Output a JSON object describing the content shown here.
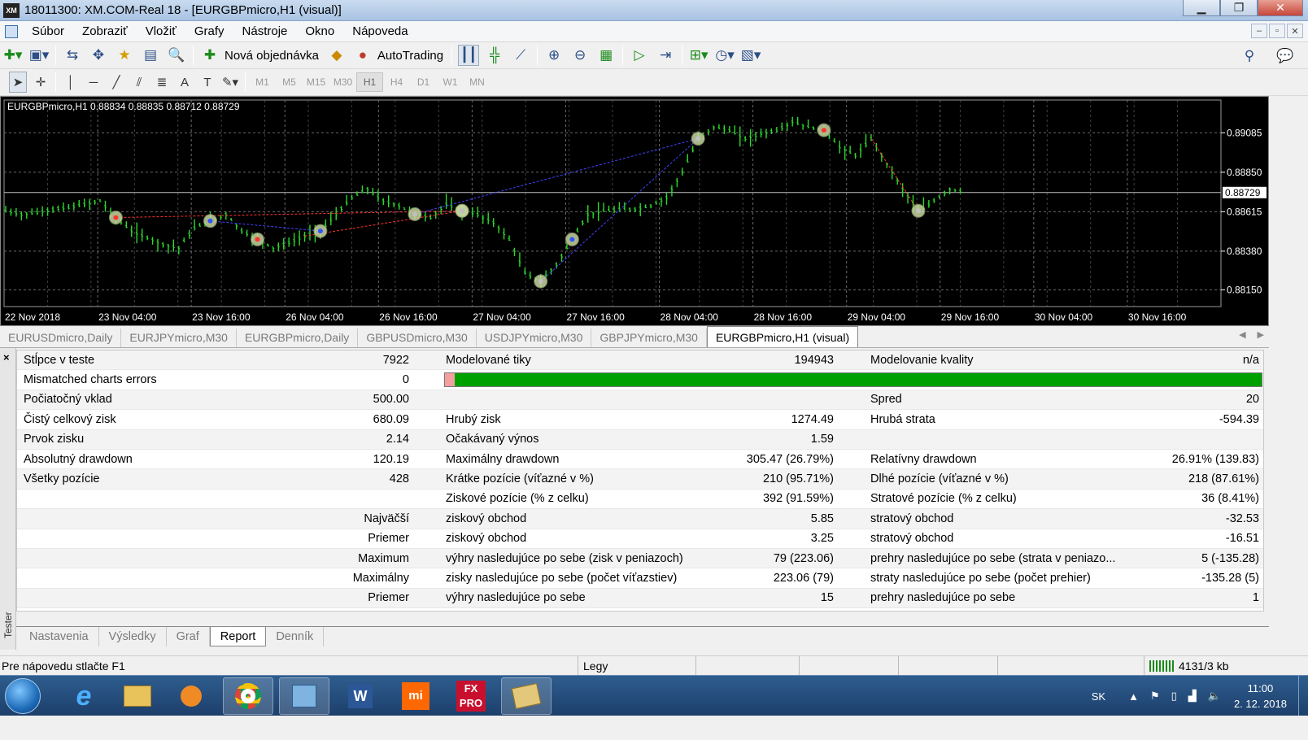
{
  "window": {
    "title": "18011300: XM.COM-Real 18 - [EURGBPmicro,H1 (visual)]",
    "logo": "XM",
    "min": "▁",
    "max": "❐",
    "close": "✕"
  },
  "menu": [
    "Súbor",
    "Zobraziť",
    "Vložiť",
    "Grafy",
    "Nástroje",
    "Okno",
    "Nápoveda"
  ],
  "toolbar": {
    "new_order": "Nová objednávka",
    "autotrading": "AutoTrading"
  },
  "timeframes": [
    "M1",
    "M5",
    "M15",
    "M30",
    "H1",
    "H4",
    "D1",
    "W1",
    "MN"
  ],
  "timeframe_active": "H1",
  "chart": {
    "header": "EURGBPmicro,H1  0.88834 0.88835 0.88712 0.88729",
    "current_price": "0.88729",
    "colors": {
      "candle_up": "#2bd92b",
      "candle_down": "#2bd92b",
      "grid": "#6b6b6b",
      "background": "#000000",
      "text": "#ffffff",
      "current_line": "#c0c0c0",
      "buy_line": "#4444ff",
      "sell_line": "#ff3333"
    },
    "chart_data": {
      "type": "line",
      "title": "EURGBPmicro,H1",
      "yticks": [
        "0.89085",
        "0.88850",
        "0.88615",
        "0.88380",
        "0.88150"
      ],
      "ytick_values": [
        0.89085,
        0.8885,
        0.88615,
        0.8838,
        0.8815
      ],
      "ylim": [
        0.8805,
        0.8928
      ],
      "xticks": [
        "22 Nov 2018",
        "23 Nov 04:00",
        "23 Nov 16:00",
        "26 Nov 04:00",
        "26 Nov 16:00",
        "27 Nov 04:00",
        "27 Nov 16:00",
        "28 Nov 04:00",
        "28 Nov 16:00",
        "29 Nov 04:00",
        "29 Nov 16:00",
        "30 Nov 04:00",
        "30 Nov 16:00"
      ],
      "grid": true,
      "series": [
        {
          "values": [
            0.8862,
            0.886,
            0.8861,
            0.8863,
            0.8864,
            0.8866,
            0.8868,
            0.8858,
            0.885,
            0.8846,
            0.8842,
            0.884,
            0.8852,
            0.8856,
            0.886,
            0.885,
            0.8845,
            0.884,
            0.8843,
            0.8847,
            0.885,
            0.886,
            0.887,
            0.8875,
            0.8868,
            0.8865,
            0.886,
            0.8858,
            0.8866,
            0.8862,
            0.886,
            0.8855,
            0.8845,
            0.8825,
            0.882,
            0.883,
            0.8845,
            0.886,
            0.8862,
            0.8863,
            0.8863,
            0.8865,
            0.887,
            0.8885,
            0.8905,
            0.8912,
            0.891,
            0.8905,
            0.8908,
            0.891,
            0.8915,
            0.8912,
            0.891,
            0.89,
            0.8895,
            0.8905,
            0.889,
            0.8875,
            0.8862,
            0.8868,
            0.8875,
            0.8873
          ]
        }
      ]
    }
  },
  "chart_tabs": [
    "EURUSDmicro,Daily",
    "EURJPYmicro,M30",
    "EURGBPmicro,Daily",
    "GBPUSDmicro,M30",
    "USDJPYmicro,M30",
    "GBPJPYmicro,M30",
    "EURGBPmicro,H1 (visual)"
  ],
  "chart_tab_active": 6,
  "tester": {
    "close": "×",
    "label": "Tester"
  },
  "report": [
    [
      "Stĺpce v teste",
      "7922",
      "Modelované tiky",
      "194943",
      "Modelovanie kvality",
      "n/a"
    ],
    [
      "Mismatched charts errors",
      "0",
      "",
      "",
      "",
      ""
    ],
    [
      "Počiatočný vklad",
      "500.00",
      "",
      "",
      "Spred",
      "20"
    ],
    [
      "Čistý celkový zisk",
      "680.09",
      "Hrubý zisk",
      "1274.49",
      "Hrubá strata",
      "-594.39"
    ],
    [
      "Prvok zisku",
      "2.14",
      "Očakávaný výnos",
      "1.59",
      "",
      ""
    ],
    [
      "Absolutný drawdown",
      "120.19",
      "Maximálny drawdown",
      "305.47 (26.79%)",
      "Relatívny drawdown",
      "26.91% (139.83)"
    ],
    [
      "Všetky pozície",
      "428",
      "Krátke pozície (víťazné v %)",
      "210 (95.71%)",
      "Dlhé pozície (víťazné v %)",
      "218 (87.61%)"
    ],
    [
      "",
      "",
      "Ziskové pozície (% z celku)",
      "392 (91.59%)",
      "Stratové pozície (% z celku)",
      "36 (8.41%)"
    ],
    [
      "",
      "Najväčší",
      "ziskový obchod",
      "5.85",
      "stratový obchod",
      "-32.53"
    ],
    [
      "",
      "Priemer",
      "ziskový obchod",
      "3.25",
      "stratový obchod",
      "-16.51"
    ],
    [
      "",
      "Maximum",
      "výhry nasledujúce po sebe (zisk v peniazoch)",
      "79 (223.06)",
      "prehry nasledujúce po sebe (strata v peniazo...",
      "5 (-135.28)"
    ],
    [
      "",
      "Maximálny",
      "zisky nasledujúce po sebe (počet víťazstiev)",
      "223.06 (79)",
      "straty nasledujúce po sebe (počet prehier)",
      "-135.28 (5)"
    ],
    [
      "",
      "Priemer",
      "výhry nasledujúce po sebe",
      "15",
      "prehry nasledujúce po sebe",
      "1"
    ]
  ],
  "modeling_quality_bar": {
    "mismatch_fraction": 0.012,
    "color_good": "#00a000",
    "color_bad": "#f2a0a0"
  },
  "tester_tabs": [
    "Nastavenia",
    "Výsledky",
    "Graf",
    "Report",
    "Denník"
  ],
  "tester_tab_active": 3,
  "status": {
    "help": "Pre nápovedu stlačte F1",
    "profile": "Legy",
    "traffic": "4131/3 kb"
  },
  "taskbar": {
    "lang": "SK",
    "time": "11:00",
    "date": "2. 12. 2018",
    "apps": [
      "internet-explorer",
      "file-explorer",
      "media-player",
      "chrome",
      "mt4-terminal",
      "word",
      "xiaomi",
      "fxpro",
      "mt4-tester"
    ]
  }
}
